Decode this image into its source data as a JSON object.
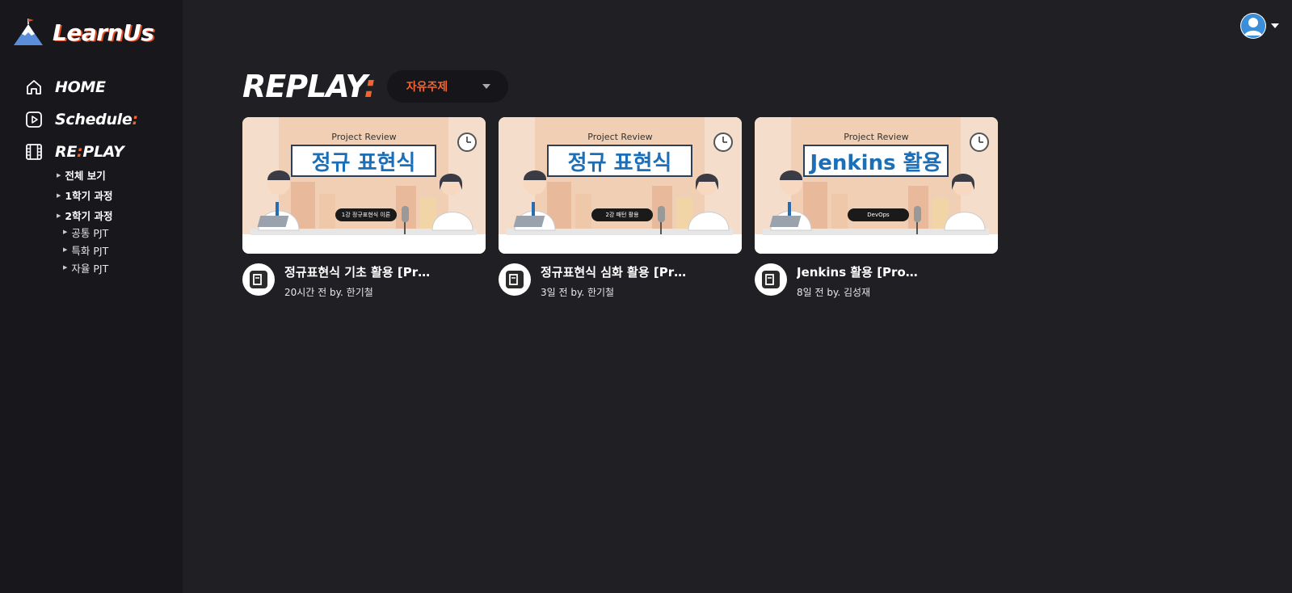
{
  "brand": {
    "name": "LearnUs"
  },
  "nav": {
    "home": "HOME",
    "schedule": "Schedule",
    "schedule_accent": ":",
    "replay_a": "RE",
    "replay_accent": ":",
    "replay_b": "PLAY",
    "sub_items": [
      "전체 보기",
      "1학기 과정",
      "2학기 과정"
    ],
    "sub2_items": [
      "공통 PJT",
      "특화 PJT",
      "자율 PJT"
    ]
  },
  "page": {
    "title": "REPLAY",
    "title_accent": ":",
    "filter_value": "자유주제"
  },
  "videos": [
    {
      "thumb_top": "Project Review",
      "thumb_banner": "정규 표현식",
      "thumb_pill": "1강 정규표현식 이론",
      "title": "정규표현식 기초 활용 [Pr…",
      "subtitle": "20시간 전 by. 한기철"
    },
    {
      "thumb_top": "Project Review",
      "thumb_banner": "정규 표현식",
      "thumb_pill": "2강 패턴 활용",
      "title": "정규표현식 심화 활용 [Pr…",
      "subtitle": "3일 전 by. 한기철"
    },
    {
      "thumb_top": "Project Review",
      "thumb_banner": "Jenkins 활용",
      "thumb_pill": "DevOps",
      "title": "Jenkins 활용 [Pro…",
      "subtitle": "8일 전 by. 김성재"
    }
  ],
  "colors": {
    "accent": "#f4642e",
    "bg": "#1f1f24",
    "sidebar": "#17171c"
  }
}
